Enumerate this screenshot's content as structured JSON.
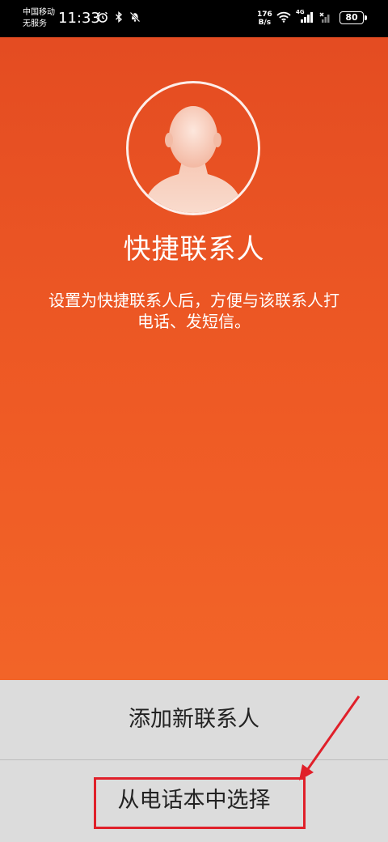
{
  "status_bar": {
    "carrier_line1": "中国移动",
    "carrier_line2": "无服务",
    "time": "11:33",
    "net_speed_value": "176",
    "net_speed_unit": "B/s",
    "network_type": "4G",
    "battery": "80"
  },
  "hero": {
    "title": "快捷联系人",
    "description": "设置为快捷联系人后，方便与该联系人打电话、发短信。"
  },
  "actions": {
    "add_new": "添加新联系人",
    "pick_from_contacts": "从电话本中选择"
  },
  "colors": {
    "hero_top": "#e44c22",
    "hero_bottom": "#f26428",
    "sheet_bg": "#dcdcdc",
    "annotation_red": "#e0202a"
  }
}
